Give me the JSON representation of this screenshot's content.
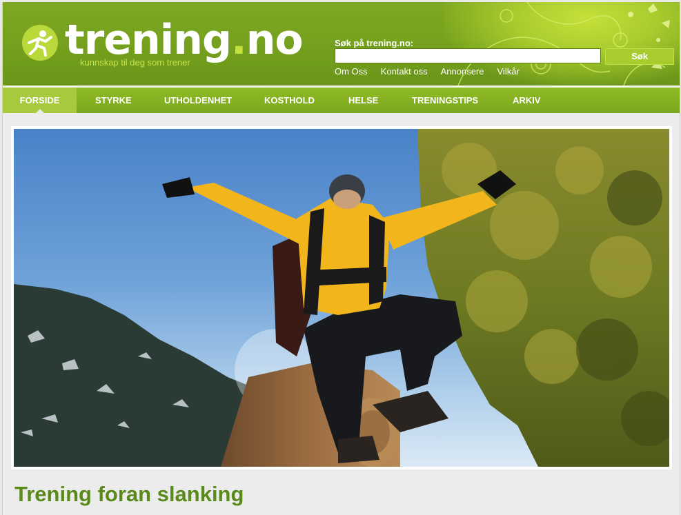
{
  "brand": {
    "logo_text": "trening",
    "logo_dot": ".",
    "logo_tld": "no",
    "tagline": "kunnskap til deg som trener"
  },
  "search": {
    "label": "Søk på trening.no:",
    "value": "",
    "button_label": "Søk"
  },
  "top_links": [
    "Om Oss",
    "Kontakt oss",
    "Annonsere",
    "Vilkår"
  ],
  "nav": {
    "items": [
      "FORSIDE",
      "STYRKE",
      "UTHOLDENHET",
      "KOSTHOLD",
      "HELSE",
      "TRENINGSTIPS",
      "ARKIV"
    ],
    "active": "FORSIDE"
  },
  "article": {
    "title": "Trening foran slanking"
  },
  "colors": {
    "brand_green": "#7fa822",
    "accent_lime": "#c4e03c",
    "title_green": "#5a8a1a"
  }
}
